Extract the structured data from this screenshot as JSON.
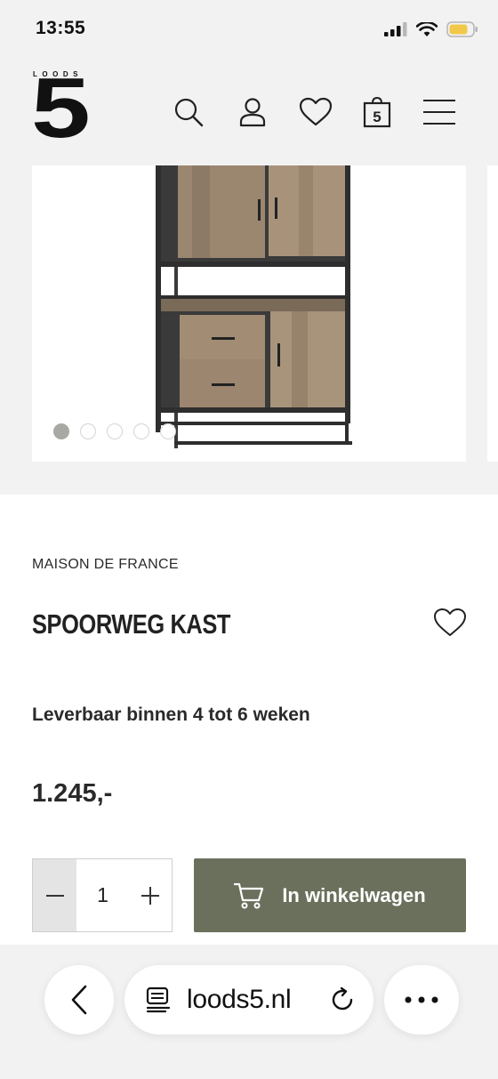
{
  "status_bar": {
    "time": "13:55"
  },
  "header": {
    "logo_small": "LOODS",
    "logo_big": "5",
    "cart_badge": "5"
  },
  "gallery": {
    "image_count": 5,
    "active_index": 0
  },
  "product": {
    "brand": "MAISON DE FRANCE",
    "title": "SPOORWEG KAST",
    "availability": "Leverbaar binnen 4 tot 6 weken",
    "price": "1.245,-"
  },
  "purchase": {
    "quantity": "1",
    "add_to_cart_label": "In winkelwagen",
    "button_color": "#6b705c"
  },
  "browser": {
    "url": "loods5.nl"
  }
}
